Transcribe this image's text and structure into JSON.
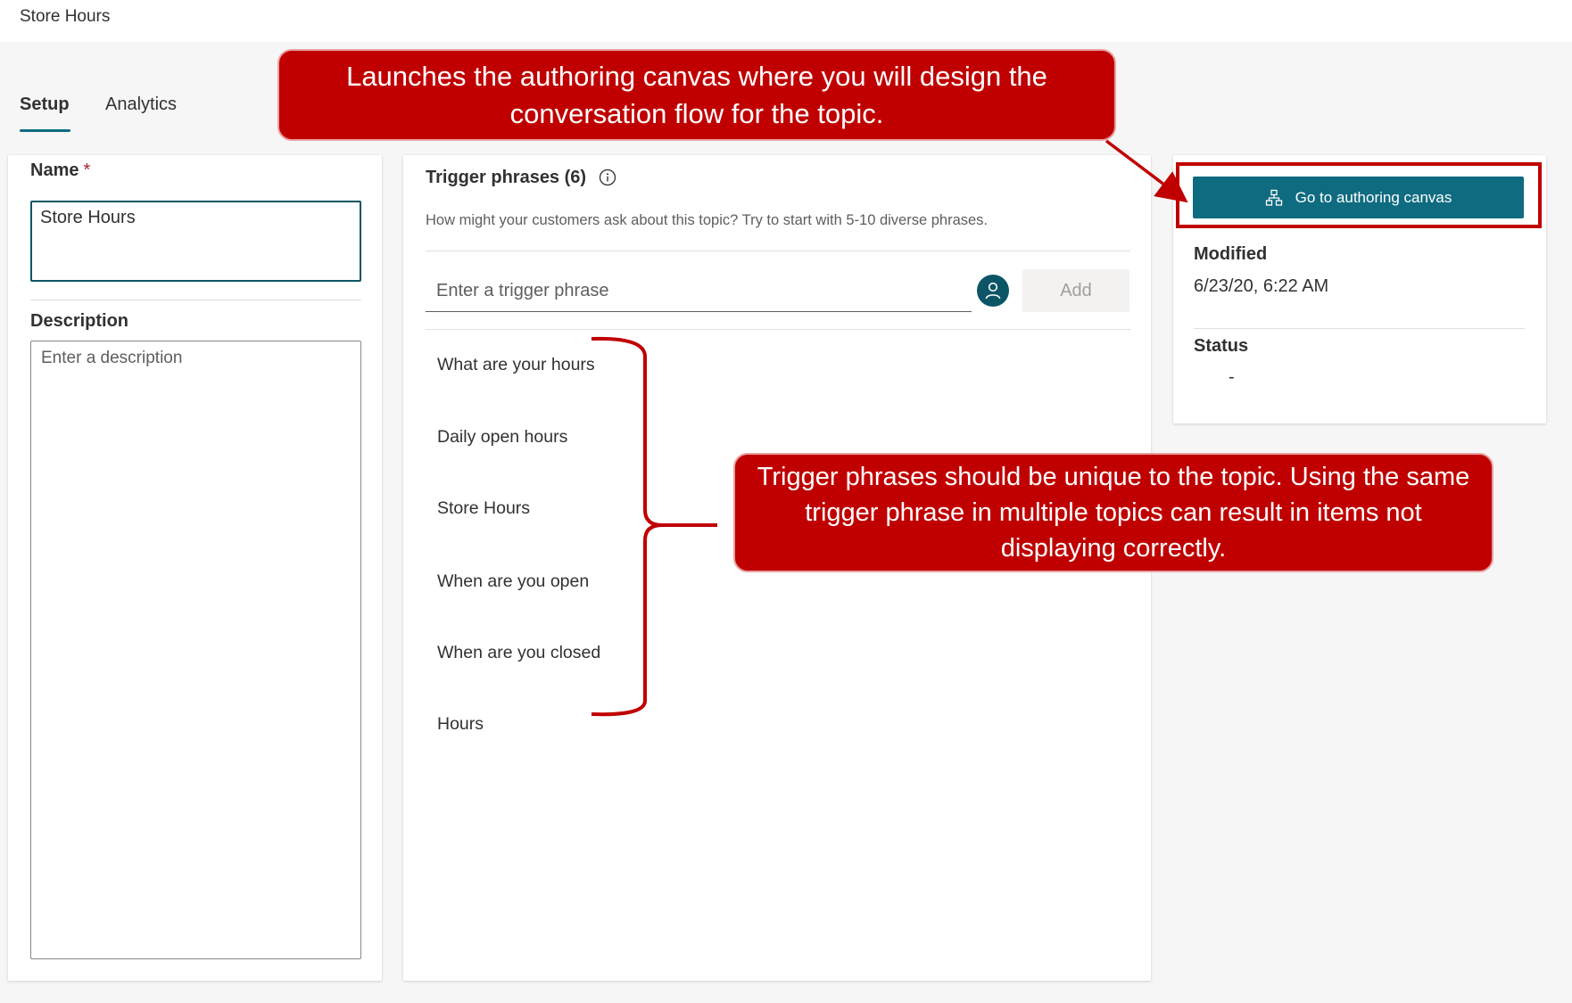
{
  "window": {
    "title": "Store Hours"
  },
  "tabs": [
    {
      "label": "Setup",
      "active": true
    },
    {
      "label": "Analytics",
      "active": false
    }
  ],
  "left_panel": {
    "name_label": "Name",
    "required_marker": "*",
    "name_value": "Store Hours",
    "description_label": "Description",
    "description_placeholder": "Enter a description"
  },
  "trigger_panel": {
    "title": "Trigger phrases (6)",
    "subtitle": "How might your customers ask about this topic? Try to start with 5-10 diverse phrases.",
    "input_placeholder": "Enter a trigger phrase",
    "add_label": "Add",
    "phrases": [
      "What are your hours",
      "Daily open hours",
      "Store Hours",
      "When are you open",
      "When are you closed",
      "Hours"
    ]
  },
  "details_panel": {
    "canvas_button_label": "Go to authoring canvas",
    "modified_label": "Modified",
    "modified_value": "6/23/20, 6:22 AM",
    "status_label": "Status",
    "status_value": "-"
  },
  "annotations": {
    "canvas_callout": "Launches the authoring canvas where you will design the conversation flow for the topic.",
    "trigger_callout": "Trigger phrases should be unique to the topic.  Using the same trigger phrase in multiple topics can result in items not displaying correctly."
  },
  "icons": {
    "info": "info-icon",
    "user": "person-icon",
    "canvas": "flow-chart-icon"
  },
  "colors": {
    "accent": "#0f6b80",
    "callout": "#c00000"
  }
}
